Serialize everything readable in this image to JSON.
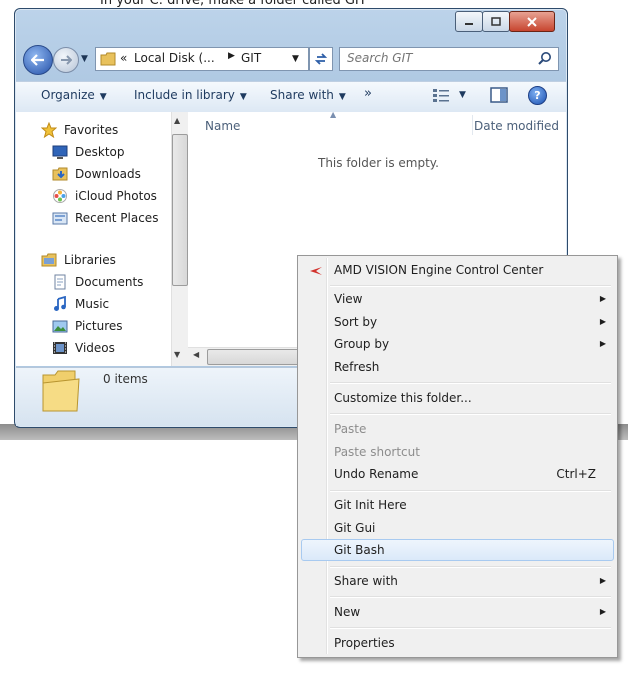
{
  "doc": {
    "caption": "In your C: drive, make a folder called GIT"
  },
  "window": {
    "address": {
      "segment1": "Local Disk (...",
      "segment2": "GIT",
      "chevron": "«",
      "separator": "▶"
    },
    "search": {
      "placeholder": "Search GIT"
    },
    "toolbar": {
      "organize": "Organize",
      "include": "Include in library",
      "share": "Share with",
      "more": "»",
      "help": "?"
    },
    "nav": {
      "items": [
        {
          "label": "Favorites",
          "icon": "star-icon"
        },
        {
          "label": "Desktop",
          "icon": "desktop-icon"
        },
        {
          "label": "Downloads",
          "icon": "downloads-icon"
        },
        {
          "label": "iCloud Photos",
          "icon": "icloud-photos-icon"
        },
        {
          "label": "Recent Places",
          "icon": "recent-places-icon"
        },
        {
          "label": "Libraries",
          "icon": "libraries-icon"
        },
        {
          "label": "Documents",
          "icon": "documents-icon"
        },
        {
          "label": "Music",
          "icon": "music-icon"
        },
        {
          "label": "Pictures",
          "icon": "pictures-icon"
        },
        {
          "label": "Videos",
          "icon": "videos-icon"
        }
      ]
    },
    "columns": {
      "name": "Name",
      "date": "Date modified"
    },
    "empty_message": "This folder is empty.",
    "details": {
      "count": "0 items"
    }
  },
  "context_menu": {
    "items": [
      {
        "label": "AMD VISION Engine Control Center"
      },
      {
        "label": "View",
        "submenu": true
      },
      {
        "label": "Sort by",
        "submenu": true
      },
      {
        "label": "Group by",
        "submenu": true
      },
      {
        "label": "Refresh"
      },
      {
        "label": "Customize this folder..."
      },
      {
        "label": "Paste",
        "disabled": true
      },
      {
        "label": "Paste shortcut",
        "disabled": true
      },
      {
        "label": "Undo Rename",
        "shortcut": "Ctrl+Z"
      },
      {
        "label": "Git Init Here"
      },
      {
        "label": "Git Gui"
      },
      {
        "label": "Git Bash",
        "highlighted": true
      },
      {
        "label": "Share with",
        "submenu": true
      },
      {
        "label": "New",
        "submenu": true
      },
      {
        "label": "Properties"
      }
    ],
    "submenu_arrow": "▶"
  },
  "colors": {
    "window_frame": "#9fbcd9",
    "menu_background": "#f0f0f0",
    "menu_highlight": "#dbe9f9",
    "disabled_text": "#8d8d8d"
  }
}
